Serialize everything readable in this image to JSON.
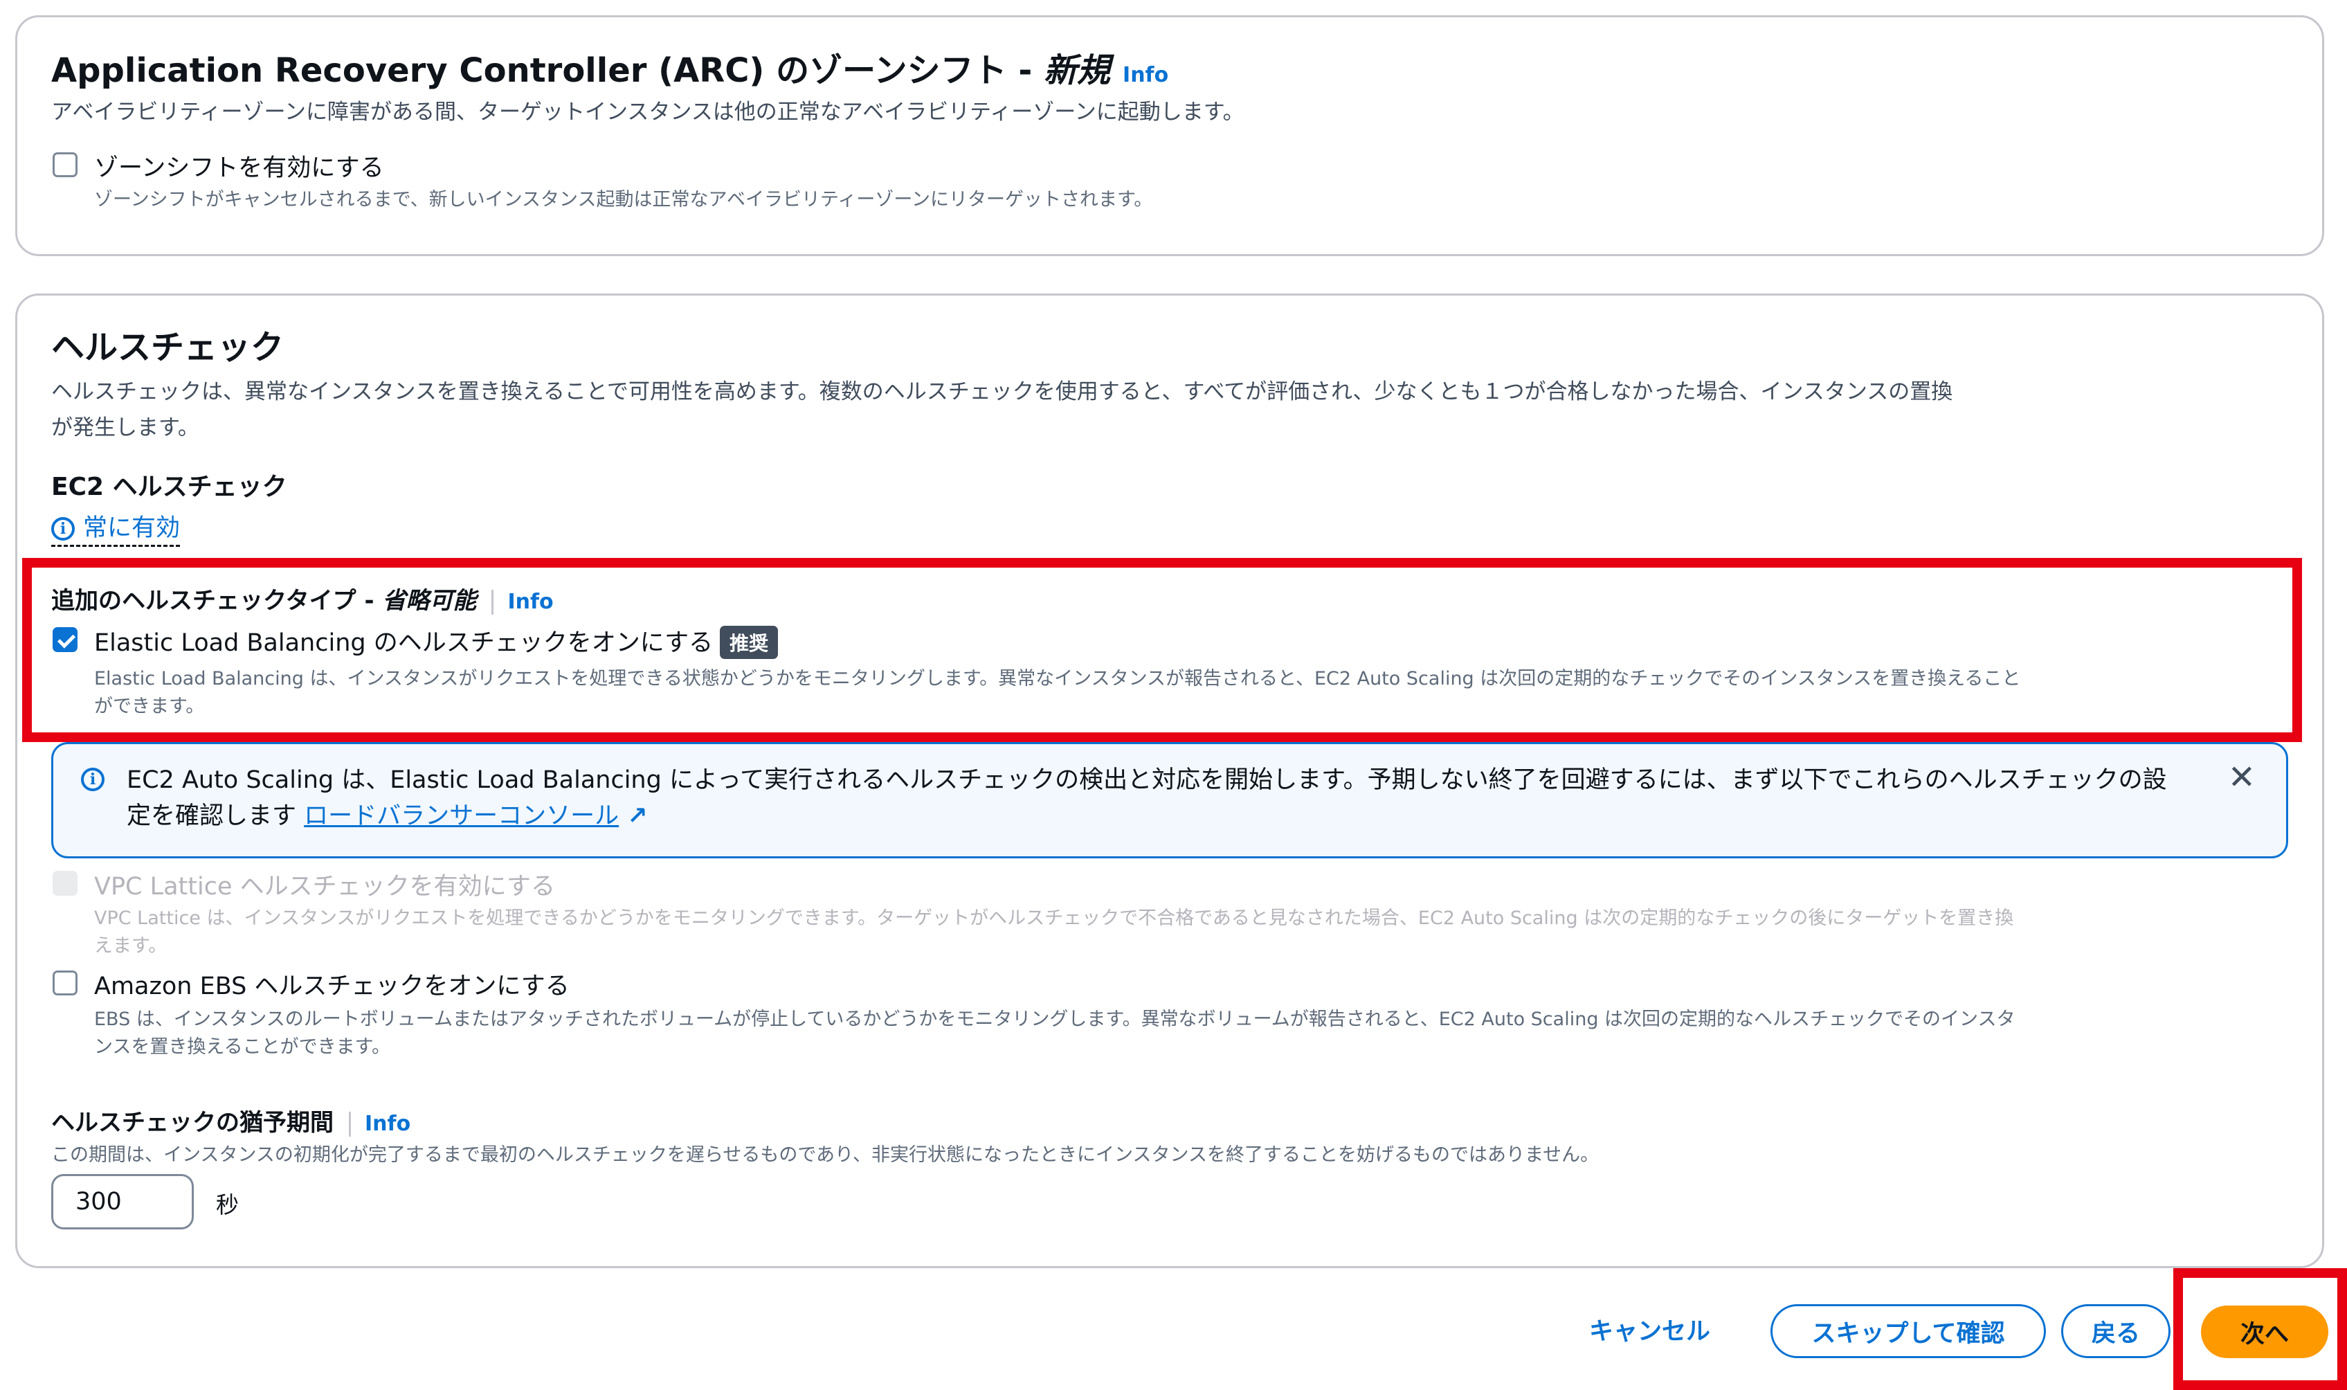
{
  "zone_shift": {
    "title": "Application Recovery Controller (ARC) のゾーンシフト - ",
    "title_new": "新規",
    "info": "Info",
    "description": "アベイラビリティーゾーンに障害がある間、ターゲットインスタンスは他の正常なアベイラビリティーゾーンに起動します。",
    "checkbox_label": "ゾーンシフトを有効にする",
    "checkbox_checked": false,
    "checkbox_desc": "ゾーンシフトがキャンセルされるまで、新しいインスタンス起動は正常なアベイラビリティーゾーンにリターゲットされます。"
  },
  "health": {
    "title": "ヘルスチェック",
    "description_line1": "ヘルスチェックは、異常なインスタンスを置き換えることで可用性を高めます。複数のヘルスチェックを使用すると、すべてが評価され、少なくとも１つが合格しなかった場合、インスタンスの置換",
    "description_line2": "が発生します。",
    "ec2_label": "EC2 ヘルスチェック",
    "ec2_status": "常に有効",
    "additional_label": "追加のヘルスチェックタイプ - ",
    "additional_optional": "省略可能",
    "info": "Info",
    "elb": {
      "label": "Elastic Load Balancing のヘルスチェックをオンにする",
      "badge": "推奨",
      "checked": true,
      "desc_line1": "Elastic Load Balancing は、インスタンスがリクエストを処理できる状態かどうかをモニタリングします。異常なインスタンスが報告されると、EC2 Auto Scaling は次回の定期的なチェックでそのインスタンスを置き換えること",
      "desc_line2": "ができます。"
    },
    "alert": {
      "text": "EC2 Auto Scaling は、Elastic Load Balancing によって実行されるヘルスチェックの検出と対応を開始します。予期しない終了を回避するには、まず以下でこれらのヘルスチェックの設定を確認します ",
      "link": "ロードバランサーコンソール"
    },
    "vpc": {
      "label": "VPC Lattice ヘルスチェックを有効にする",
      "desc_line1": "VPC Lattice は、インスタンスがリクエストを処理できるかどうかをモニタリングできます。ターゲットがヘルスチェックで不合格であると見なされた場合、EC2 Auto Scaling は次の定期的なチェックの後にターゲットを置き換",
      "desc_line2": "えます。"
    },
    "ebs": {
      "label": "Amazon EBS ヘルスチェックをオンにする",
      "checked": false,
      "desc_line1": "EBS は、インスタンスのルートボリュームまたはアタッチされたボリュームが停止しているかどうかをモニタリングします。異常なボリュームが報告されると、EC2 Auto Scaling は次回の定期的なヘルスチェックでそのインスタ",
      "desc_line2": "ンスを置き換えることができます。"
    },
    "grace_label": "ヘルスチェックの猶予期間",
    "grace_desc": "この期間は、インスタンスの初期化が完了するまで最初のヘルスチェックを遅らせるものであり、非実行状態になったときにインスタンスを終了することを妨げるものではありません。",
    "grace_value": "300",
    "grace_unit": "秒"
  },
  "footer": {
    "cancel": "キャンセル",
    "skip": "スキップして確認",
    "back": "戻る",
    "next": "次へ"
  },
  "colors": {
    "accent": "#0972d3",
    "primary_button": "#ff9900",
    "highlight_border": "#e60012"
  }
}
